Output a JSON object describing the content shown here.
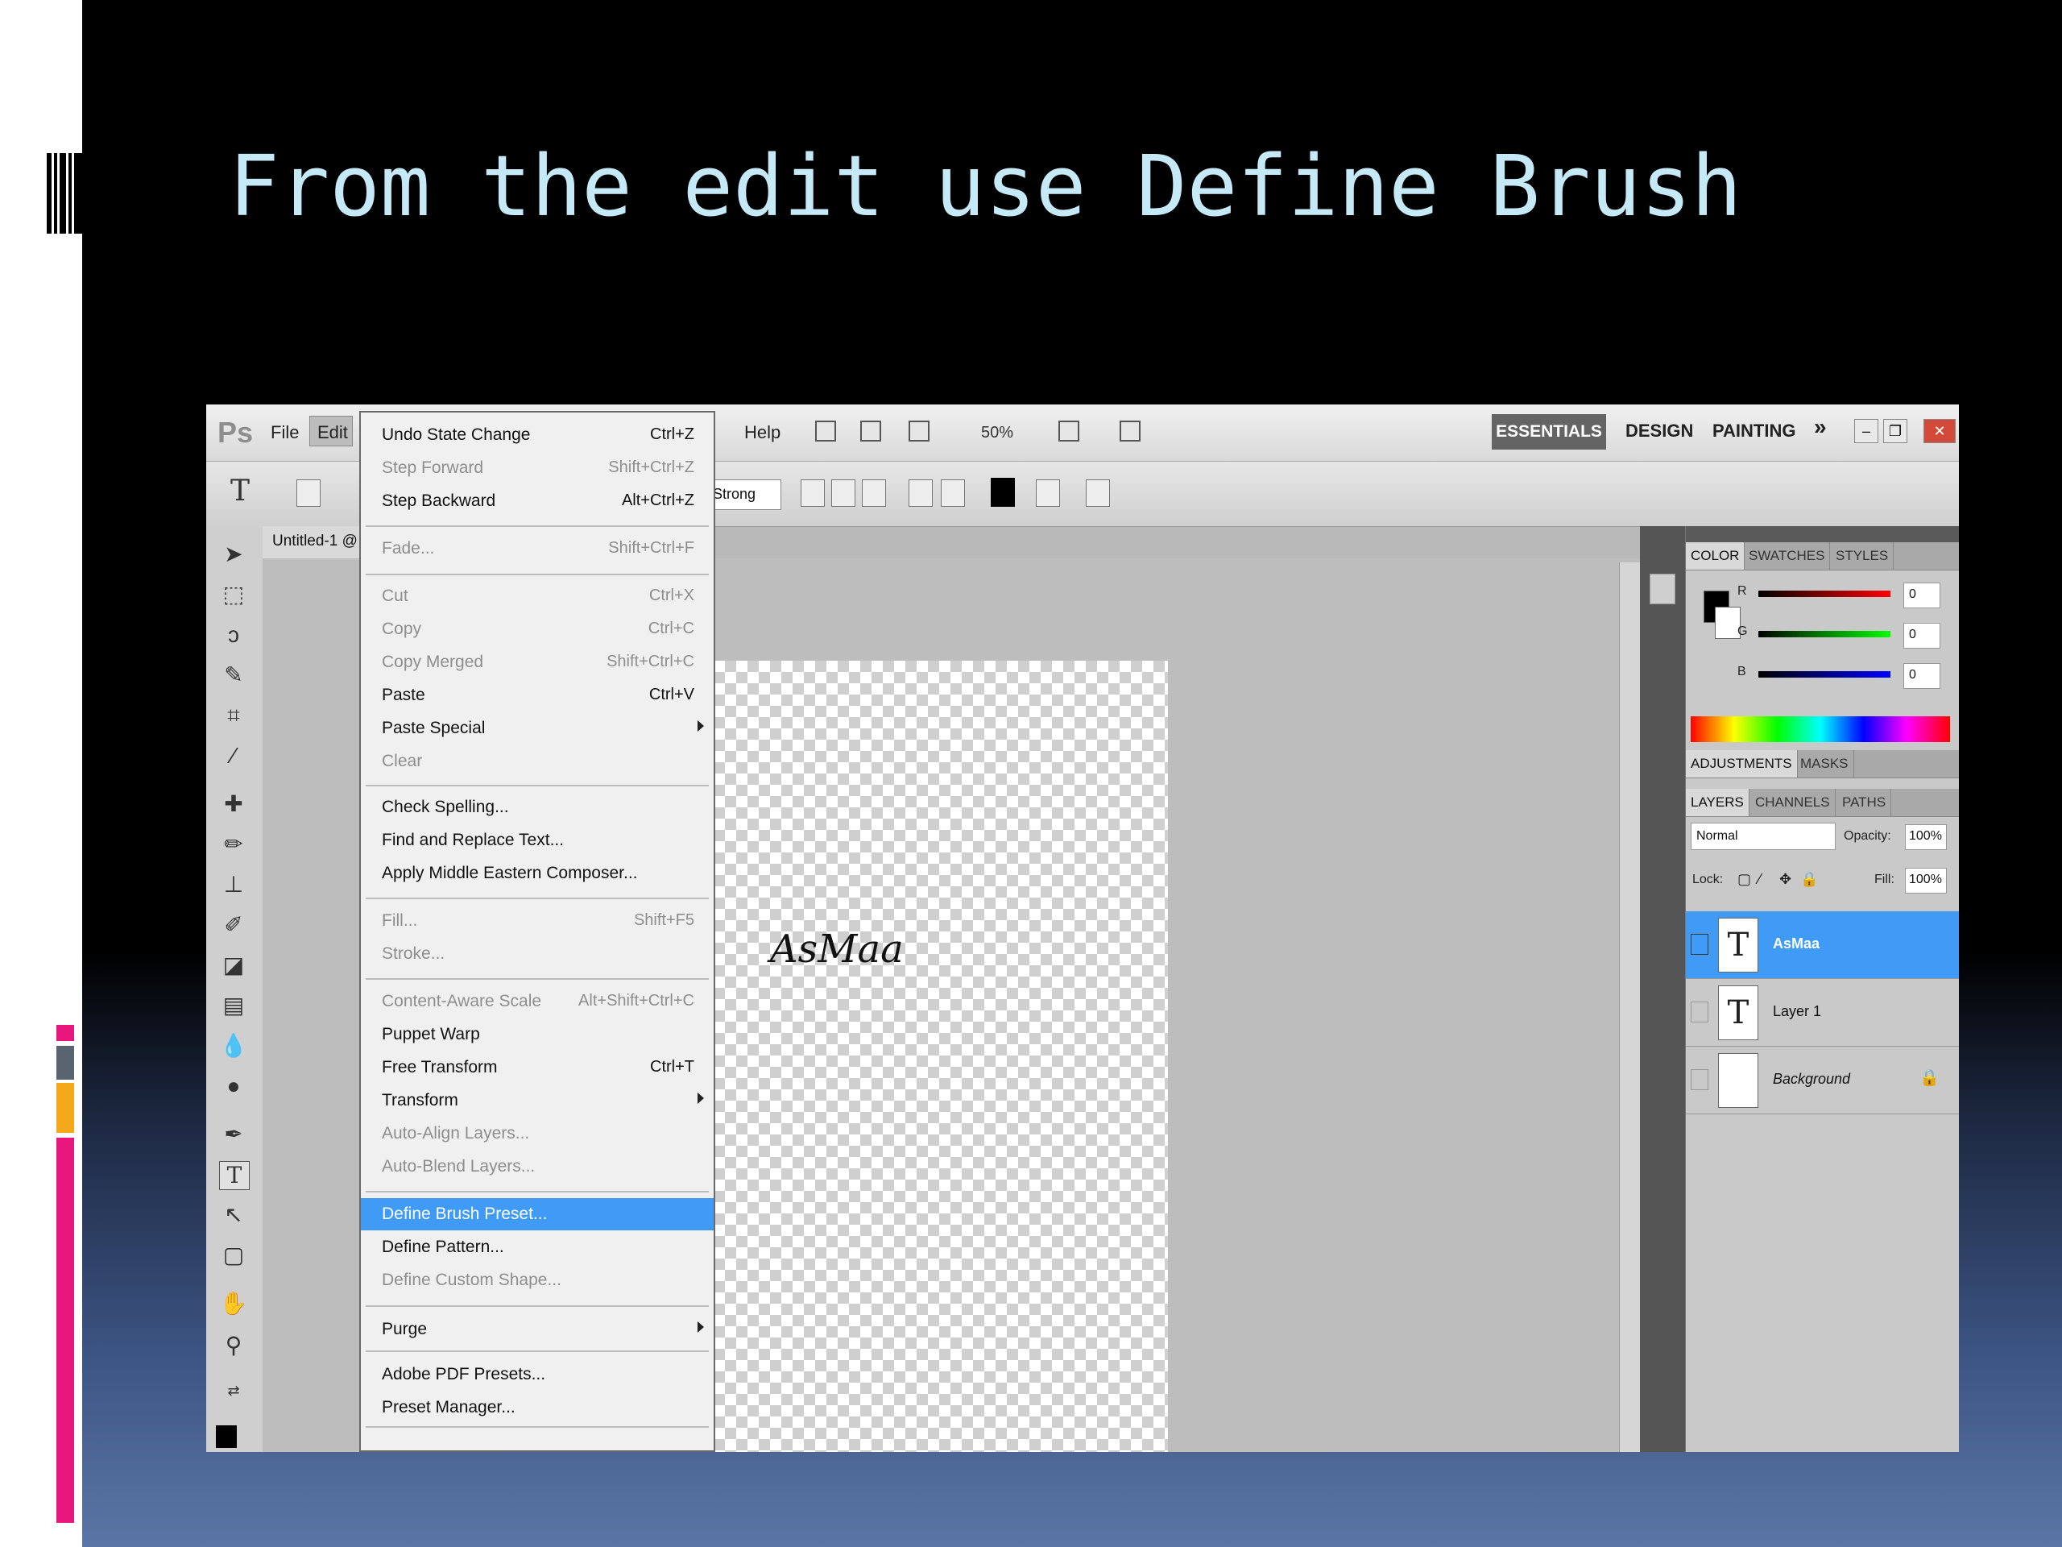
{
  "slide": {
    "title": "From the edit use Define Brush"
  },
  "app": {
    "logo": "Ps",
    "menu": [
      "File",
      "Edit",
      "Help"
    ],
    "zoom": "50%",
    "workspaces": [
      "ESSENTIALS",
      "DESIGN",
      "PAINTING"
    ],
    "workspace_more": "»",
    "window_buttons": [
      "–",
      "❐",
      "✕"
    ],
    "options": {
      "tool_glyph": "T",
      "anti_alias": "Strong"
    },
    "document_tab": "Untitled-1 @",
    "canvas_text": "AsMaa"
  },
  "edit_menu": {
    "items": [
      {
        "label": "Undo State Change",
        "shortcut": "Ctrl+Z",
        "enabled": true
      },
      {
        "label": "Step Forward",
        "shortcut": "Shift+Ctrl+Z",
        "enabled": false
      },
      {
        "label": "Step Backward",
        "shortcut": "Alt+Ctrl+Z",
        "enabled": true
      },
      {
        "label": "Fade...",
        "shortcut": "Shift+Ctrl+F",
        "enabled": false
      },
      {
        "label": "Cut",
        "shortcut": "Ctrl+X",
        "enabled": false
      },
      {
        "label": "Copy",
        "shortcut": "Ctrl+C",
        "enabled": false
      },
      {
        "label": "Copy Merged",
        "shortcut": "Shift+Ctrl+C",
        "enabled": false
      },
      {
        "label": "Paste",
        "shortcut": "Ctrl+V",
        "enabled": true
      },
      {
        "label": "Paste Special",
        "shortcut": "",
        "enabled": true,
        "submenu": true
      },
      {
        "label": "Clear",
        "shortcut": "",
        "enabled": false
      },
      {
        "label": "Check Spelling...",
        "shortcut": "",
        "enabled": true
      },
      {
        "label": "Find and Replace Text...",
        "shortcut": "",
        "enabled": true
      },
      {
        "label": "Apply Middle Eastern Composer...",
        "shortcut": "",
        "enabled": true
      },
      {
        "label": "Fill...",
        "shortcut": "Shift+F5",
        "enabled": false
      },
      {
        "label": "Stroke...",
        "shortcut": "",
        "enabled": false
      },
      {
        "label": "Content-Aware Scale",
        "shortcut": "Alt+Shift+Ctrl+C",
        "enabled": false
      },
      {
        "label": "Puppet Warp",
        "shortcut": "",
        "enabled": true
      },
      {
        "label": "Free Transform",
        "shortcut": "Ctrl+T",
        "enabled": true
      },
      {
        "label": "Transform",
        "shortcut": "",
        "enabled": true,
        "submenu": true
      },
      {
        "label": "Auto-Align Layers...",
        "shortcut": "",
        "enabled": false
      },
      {
        "label": "Auto-Blend Layers...",
        "shortcut": "",
        "enabled": false
      },
      {
        "label": "Define Brush Preset...",
        "shortcut": "",
        "enabled": true,
        "highlighted": true
      },
      {
        "label": "Define Pattern...",
        "shortcut": "",
        "enabled": true
      },
      {
        "label": "Define Custom Shape...",
        "shortcut": "",
        "enabled": false
      },
      {
        "label": "Purge",
        "shortcut": "",
        "enabled": true,
        "submenu": true
      },
      {
        "label": "Adobe PDF Presets...",
        "shortcut": "",
        "enabled": true
      },
      {
        "label": "Preset Manager...",
        "shortcut": "",
        "enabled": true
      }
    ]
  },
  "panels": {
    "color_tabs": [
      "COLOR",
      "SWATCHES",
      "STYLES"
    ],
    "color": {
      "r_label": "R",
      "g_label": "G",
      "b_label": "B",
      "r": "0",
      "g": "0",
      "b": "0"
    },
    "adjust_tabs": [
      "ADJUSTMENTS",
      "MASKS"
    ],
    "layer_tabs": [
      "LAYERS",
      "CHANNELS",
      "PATHS"
    ],
    "blend_mode": "Normal",
    "opacity_label": "Opacity:",
    "opacity": "100%",
    "lock_label": "Lock:",
    "fill_label": "Fill:",
    "fill": "100%",
    "layers": [
      {
        "name": "AsMaa",
        "thumb": "T",
        "selected": true
      },
      {
        "name": "Layer 1",
        "thumb": "T",
        "selected": false
      },
      {
        "name": "Background",
        "thumb": "",
        "selected": false
      }
    ]
  },
  "colors": {
    "title": "#c6e9f7",
    "menu_highlight": "#3f9bf5",
    "accent_pink": "#e8177e",
    "accent_orange": "#f4a81a",
    "accent_gray": "#5a6470"
  }
}
